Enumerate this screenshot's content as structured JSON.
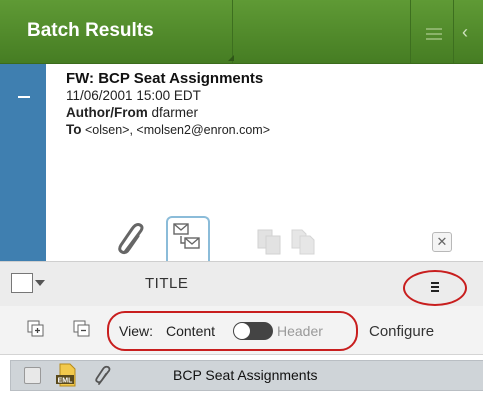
{
  "header": {
    "title": "Batch Results"
  },
  "email": {
    "subject": "FW: BCP Seat Assignments",
    "datetime": "11/06/2001 15:00 EDT",
    "author_label": "Author/From",
    "author_value": "dfarmer",
    "to_label": "To",
    "to_value": "<olsen>, <molsen2@enron.com>"
  },
  "titlebar": {
    "label": "TITLE"
  },
  "toolbar": {
    "view_label": "View:",
    "content_label": "Content",
    "header_label": "Header",
    "configure_label": "Configure"
  },
  "results": [
    {
      "title": "BCP Seat Assignments",
      "type": "EML"
    }
  ],
  "colors": {
    "header_green": "#4f8a2a",
    "card_strip_blue": "#3f7fb0",
    "highlight_red": "#c81e1e"
  }
}
